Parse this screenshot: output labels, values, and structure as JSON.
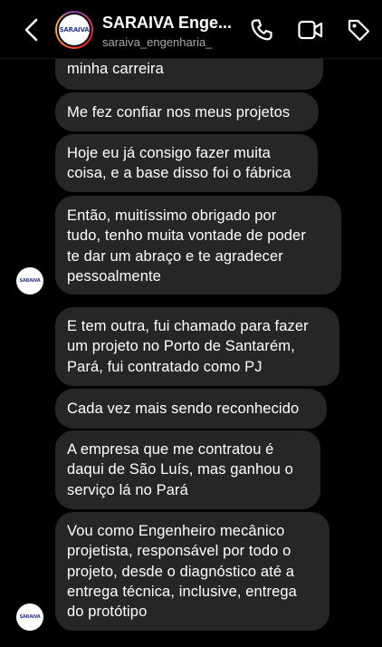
{
  "header": {
    "title": "SARAIVA Enge...",
    "username": "saraiva_engenharia_",
    "avatar_text": "SARAIVA"
  },
  "messages": [
    {
      "text": "minha carreira"
    },
    {
      "text": "Me fez confiar nos meus projetos"
    },
    {
      "text": "Hoje eu já consigo fazer muita\ncoisa, e a base disso foi o fábrica"
    },
    {
      "text": "Então, muitíssimo obrigado por\ntudo, tenho muita vontade de poder\nte dar um abraço e te agradecer\npessoalmente"
    },
    {
      "text": "E tem outra, fui chamado para fazer\num projeto no Porto de Santarém,\nPará, fui contratado como PJ"
    },
    {
      "text": "Cada vez mais sendo reconhecido"
    },
    {
      "text": "A empresa que me contratou é\ndaqui de São Luís, mas ganhou o\nserviço lá no Pará"
    },
    {
      "text": "Vou como Engenheiro mecânico\nprojetista, responsável por todo o\nprojeto, desde o diagnóstico até a\nentrega técnica, inclusive, entrega\ndo protótipo"
    }
  ],
  "icons": {
    "back": "chevron-left-icon",
    "call": "phone-icon",
    "video": "video-camera-icon",
    "tag": "tag-icon"
  },
  "colors": {
    "background": "#000000",
    "bubble": "#262626",
    "text": "#ffffff",
    "subtext": "#a8a8a8"
  }
}
